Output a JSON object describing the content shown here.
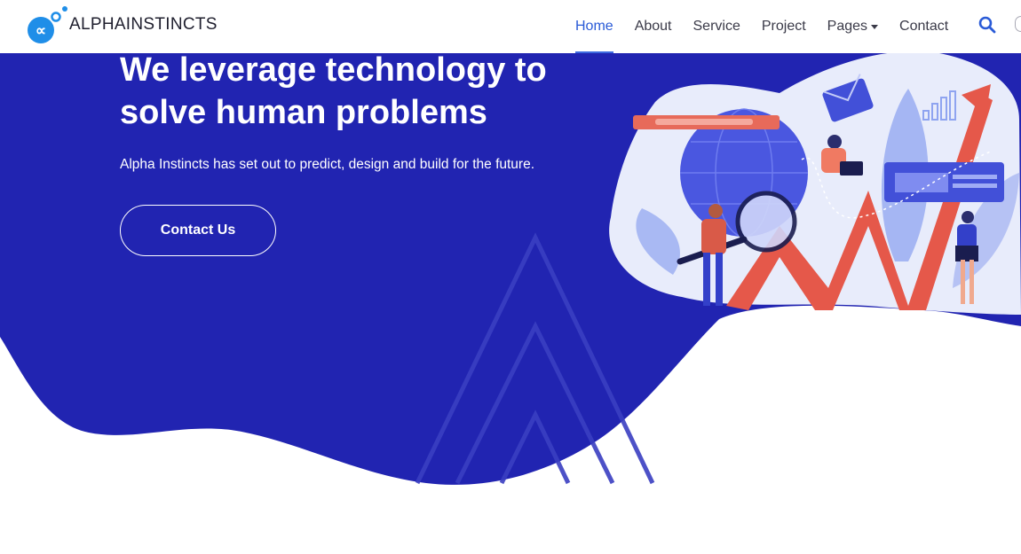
{
  "brand": {
    "name": "ALPHAINSTINCTS"
  },
  "nav": {
    "items": [
      {
        "label": "Home",
        "active": true
      },
      {
        "label": "About",
        "active": false
      },
      {
        "label": "Service",
        "active": false
      },
      {
        "label": "Project",
        "active": false
      },
      {
        "label": "Pages",
        "active": false,
        "dropdown": true
      },
      {
        "label": "Contact",
        "active": false
      }
    ],
    "search_icon": "search-icon"
  },
  "hero": {
    "title": "We leverage technology to solve human problems",
    "subtitle": "Alpha Instincts has set out to predict, design and build for the future.",
    "cta_label": "Contact Us"
  },
  "colors": {
    "hero_bg": "#2124b1",
    "accent": "#2a5bd7",
    "white": "#ffffff",
    "illustration_red": "#e5584a",
    "illustration_light": "#e8ecfb"
  }
}
